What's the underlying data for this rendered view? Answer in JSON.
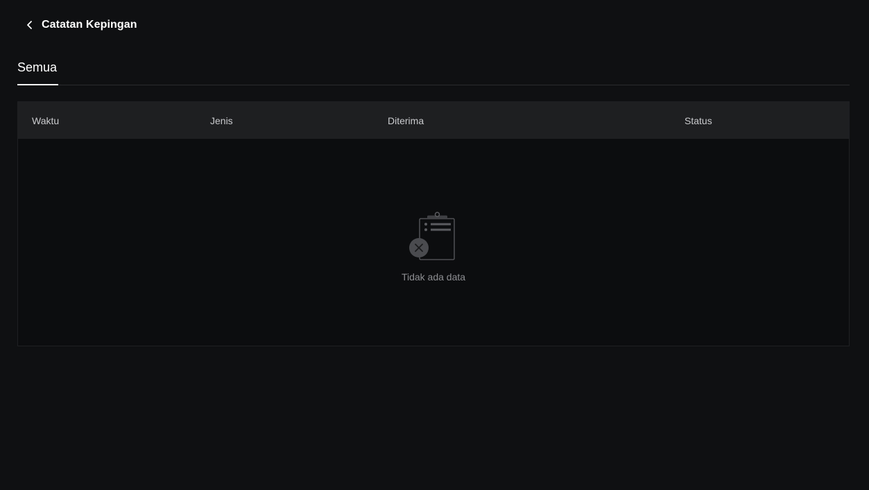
{
  "header": {
    "title": "Catatan Kepingan",
    "back_icon": "chevron-left-icon"
  },
  "tabs": [
    {
      "label": "Semua",
      "active": true
    }
  ],
  "table": {
    "columns": [
      "Waktu",
      "Jenis",
      "Diterima",
      "Status"
    ],
    "rows": []
  },
  "empty_state": {
    "icon": "empty-clipboard-icon",
    "text": "Tidak ada data"
  },
  "colors": {
    "background": "#0f1012",
    "table_header": "#1e1f21",
    "text_primary": "#ffffff",
    "text_muted": "#8d8e92"
  }
}
